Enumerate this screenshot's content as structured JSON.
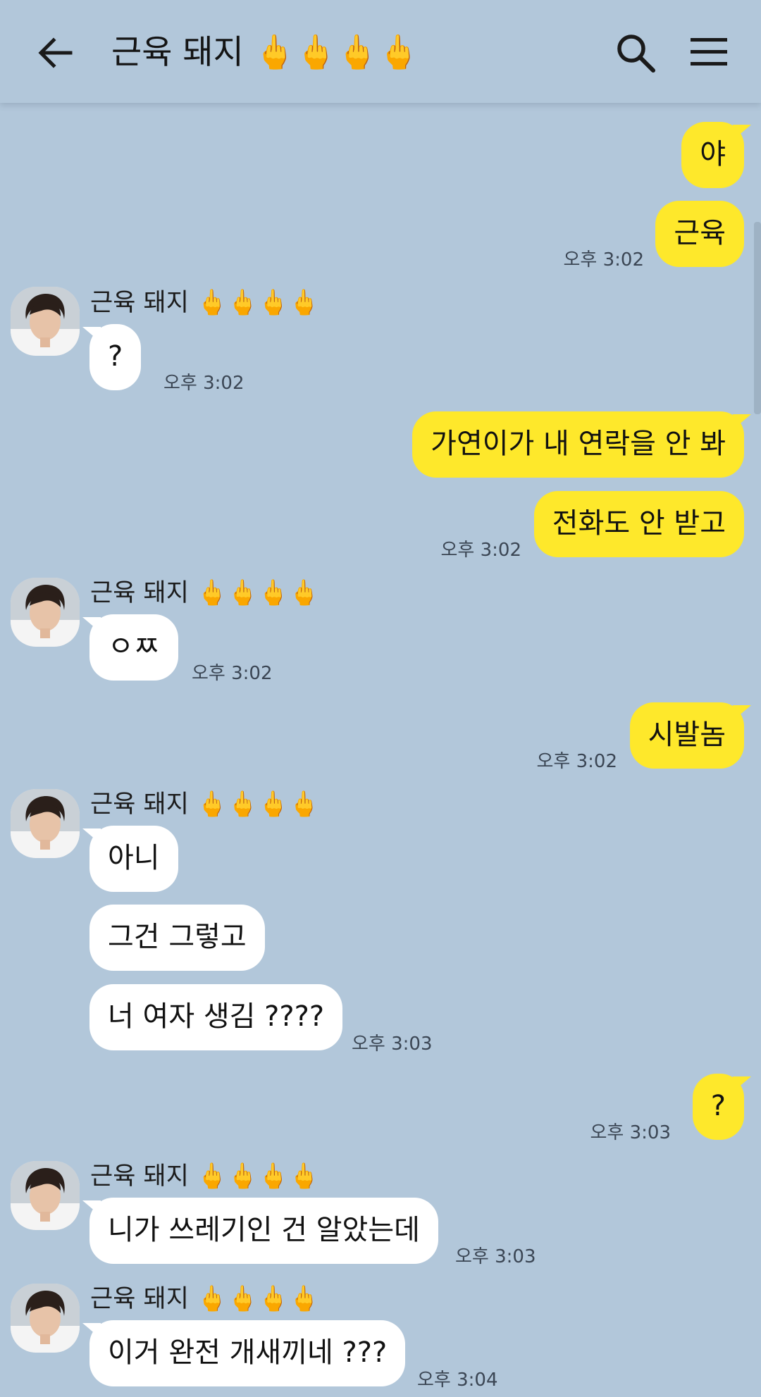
{
  "header": {
    "title": "근육 돼지 🖕🖕🖕🖕",
    "back_icon": "back-arrow-icon",
    "search_icon": "search-icon",
    "menu_icon": "hamburger-menu-icon"
  },
  "colors": {
    "background": "#b2c7da",
    "my_bubble": "#fee82b",
    "their_bubble": "#ffffff"
  },
  "messages": {
    "m1": {
      "text": "야"
    },
    "m2": {
      "text": "근육",
      "time": "오후 3:02"
    },
    "g1": {
      "sender": "근육 돼지 🖕🖕🖕🖕",
      "text": "?",
      "time": "오후 3:02"
    },
    "m3": {
      "text": "가연이가 내 연락을 안 봐"
    },
    "m4": {
      "text": "전화도 안 받고",
      "time": "오후 3:02"
    },
    "g2": {
      "sender": "근육 돼지 🖕🖕🖕🖕",
      "text": "ㅇㅉ",
      "time": "오후 3:02"
    },
    "m5": {
      "text": "시발놈",
      "time": "오후 3:02"
    },
    "g3": {
      "sender": "근육 돼지 🖕🖕🖕🖕",
      "text1": "아니",
      "text2": "그건 그렇고",
      "text3": "너 여자 생김 ????",
      "time": "오후 3:03"
    },
    "m6": {
      "text": "?",
      "time": "오후 3:03"
    },
    "g4": {
      "sender": "근육 돼지 🖕🖕🖕🖕",
      "text": "니가 쓰레기인 건 알았는데",
      "time": "오후 3:03"
    },
    "g5": {
      "sender": "근육 돼지 🖕🖕🖕🖕",
      "text": "이거 완전 개새끼네 ???",
      "time": "오후 3:04"
    }
  }
}
